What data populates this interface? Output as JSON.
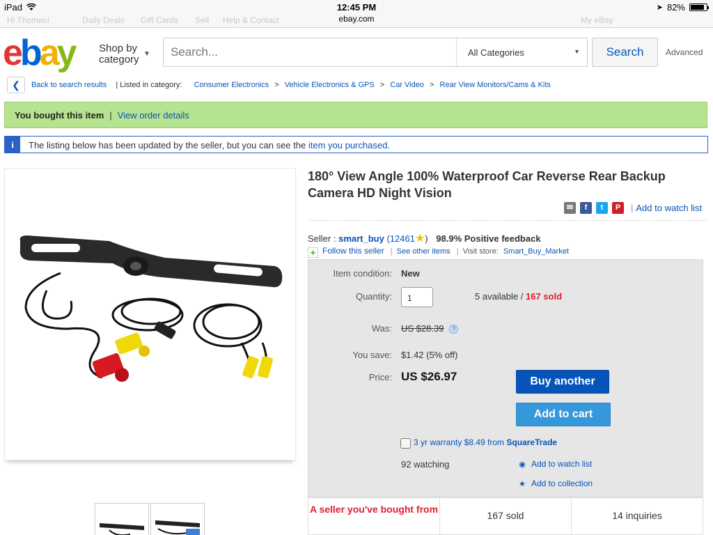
{
  "status_bar": {
    "device": "iPad",
    "time": "12:45 PM",
    "battery": "82%"
  },
  "browser": {
    "url": "ebay.com"
  },
  "ghost_header": {
    "user": "Hi Thomas!",
    "daily_deals": "Daily Deals",
    "gift_cards": "Gift Cards",
    "sell": "Sell",
    "help": "Help & Contact",
    "my_ebay": "My eBay"
  },
  "header": {
    "logo": {
      "e": "e",
      "b": "b",
      "a": "a",
      "y": "y"
    },
    "shop_by_line1": "Shop by",
    "shop_by_line2": "category",
    "search_placeholder": "Search...",
    "category_select": "All Categories",
    "search_button": "Search",
    "advanced": "Advanced"
  },
  "breadcrumb": {
    "back": "Back to search results",
    "listed_in": "| Listed in category:",
    "items": [
      "Consumer Electronics",
      "Vehicle Electronics & GPS",
      "Car Video",
      "Rear View Monitors/Cams & Kits"
    ],
    "separator": ">"
  },
  "bought_banner": {
    "text": "You bought this item",
    "link": "View order details"
  },
  "info_banner": {
    "icon": "i",
    "text": "The listing below has been updated by the seller, but you can see the",
    "link": "item you purchased",
    "end": "."
  },
  "product": {
    "title": "180° View Angle 100% Waterproof Car Reverse Rear Backup Camera HD Night Vision",
    "add_to_watch_list": "Add to watch list"
  },
  "seller": {
    "label": "Seller :",
    "name": "smart_buy",
    "score": "(12461",
    "score_end": ")",
    "feedback": "98.9% Positive feedback",
    "follow": "Follow this seller",
    "see_other": "See other items",
    "visit_store_label": "Visit store:",
    "store": "Smart_Buy_Market"
  },
  "buybox": {
    "condition_label": "Item condition:",
    "condition": "New",
    "quantity_label": "Quantity:",
    "quantity": "1",
    "available": "5 available /",
    "sold": "167 sold",
    "was_label": "Was:",
    "was": "US $28.39",
    "save_label": "You save:",
    "save": "$1.42 (5% off)",
    "price_label": "Price:",
    "price": "US $26.97",
    "buy_another": "Buy another",
    "add_to_cart": "Add to cart",
    "warranty": "3 yr warranty $8.49 from",
    "warranty_brand": "SquareTrade",
    "watching": "92 watching",
    "add_watch": "Add to watch list",
    "add_collection": "Add to collection"
  },
  "stats": {
    "seller_bought": "A seller you've bought from",
    "sold": "167 sold",
    "inquiries": "14 inquiries"
  },
  "colors": {
    "ebay_red": "#e53238",
    "ebay_blue": "#0654ba",
    "ebay_yellow": "#f5af02",
    "ebay_green": "#86b817",
    "bought_green": "#b6e38f"
  }
}
